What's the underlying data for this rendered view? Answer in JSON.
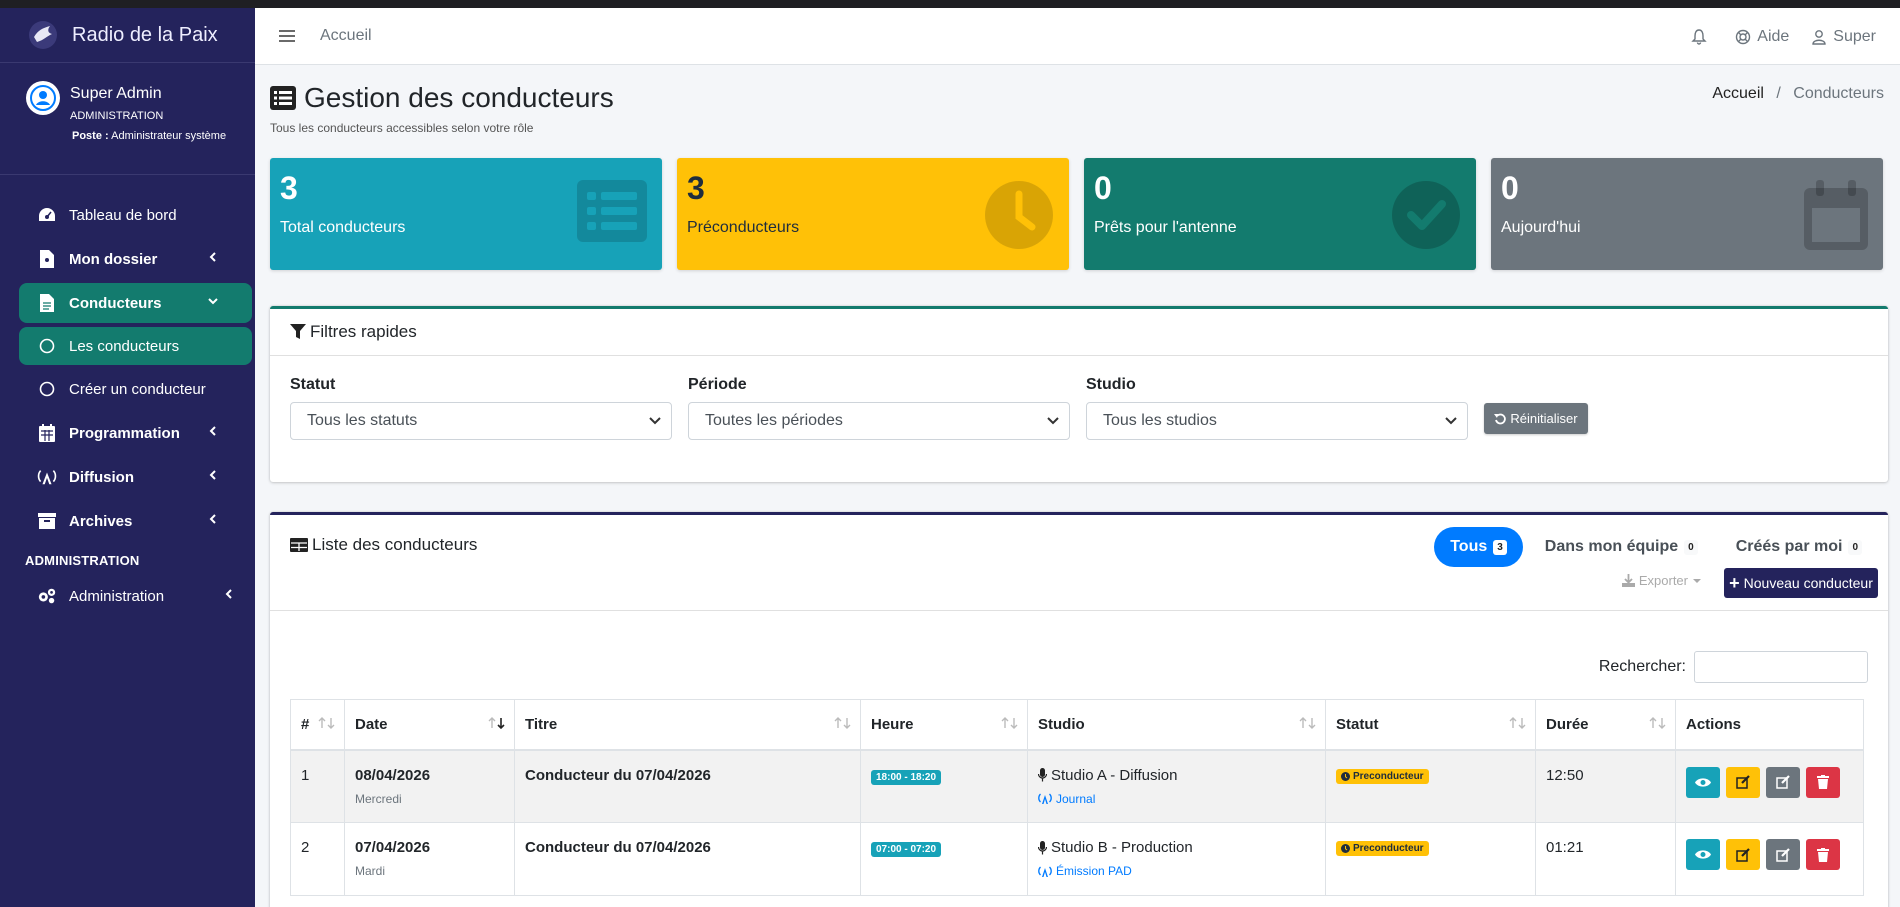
{
  "app": {
    "name": "Radio de la Paix"
  },
  "user": {
    "name": "Super Admin",
    "role": "ADMINISTRATION",
    "post_label": "Poste :",
    "post_value": "Administrateur système"
  },
  "sidebar": {
    "items": [
      {
        "label": "Tableau de bord"
      },
      {
        "label": "Mon dossier"
      },
      {
        "label": "Conducteurs"
      },
      {
        "label": "Les conducteurs"
      },
      {
        "label": "Créer un conducteur"
      },
      {
        "label": "Programmation"
      },
      {
        "label": "Diffusion"
      },
      {
        "label": "Archives"
      }
    ],
    "header": "ADMINISTRATION",
    "admin_item": {
      "label": "Administration"
    }
  },
  "navbar": {
    "home": "Accueil",
    "help": "Aide",
    "user": "Super"
  },
  "page": {
    "title": "Gestion des conducteurs",
    "subtitle": "Tous les conducteurs accessibles selon votre rôle",
    "breadcrumb": {
      "home": "Accueil",
      "sep": "/",
      "current": "Conducteurs"
    }
  },
  "stats": [
    {
      "value": "3",
      "label": "Total conducteurs",
      "color": "#17a2b8"
    },
    {
      "value": "3",
      "label": "Préconducteurs",
      "color": "#ffc107"
    },
    {
      "value": "0",
      "label": "Prêts pour l'antenne",
      "color": "#137b6e"
    },
    {
      "value": "0",
      "label": "Aujourd'hui",
      "color": "#6c757d"
    }
  ],
  "filters": {
    "title": "Filtres rapides",
    "statut": {
      "label": "Statut",
      "value": "Tous les statuts"
    },
    "periode": {
      "label": "Période",
      "value": "Toutes les périodes"
    },
    "studio": {
      "label": "Studio",
      "value": "Tous les studios"
    },
    "reset": "Réinitialiser"
  },
  "list": {
    "title": "Liste des conducteurs",
    "tabs": [
      {
        "label": "Tous",
        "count": "3"
      },
      {
        "label": "Dans mon équipe",
        "count": "0"
      },
      {
        "label": "Créés par moi",
        "count": "0"
      }
    ],
    "export": "Exporter",
    "new_button": "Nouveau conducteur",
    "search_label": "Rechercher:",
    "columns": [
      "#",
      "Date",
      "Titre",
      "Heure",
      "Studio",
      "Statut",
      "Durée",
      "Actions"
    ],
    "rows": [
      {
        "num": "1",
        "date": "08/04/2026",
        "day": "Mercredi",
        "title": "Conducteur du 07/04/2026",
        "time": "18:00 - 18:20",
        "studio": "Studio A - Diffusion",
        "emission": "Journal",
        "status": "Preconducteur",
        "duration": "12:50"
      },
      {
        "num": "2",
        "date": "07/04/2026",
        "day": "Mardi",
        "title": "Conducteur du 07/04/2026",
        "time": "07:00 - 07:20",
        "studio": "Studio B - Production",
        "emission": "Émission PAD",
        "status": "Preconducteur",
        "duration": "01:21"
      }
    ]
  },
  "colors": {
    "sidebar": "#24235c",
    "primary": "#137b6e",
    "accent": "#007bff"
  }
}
